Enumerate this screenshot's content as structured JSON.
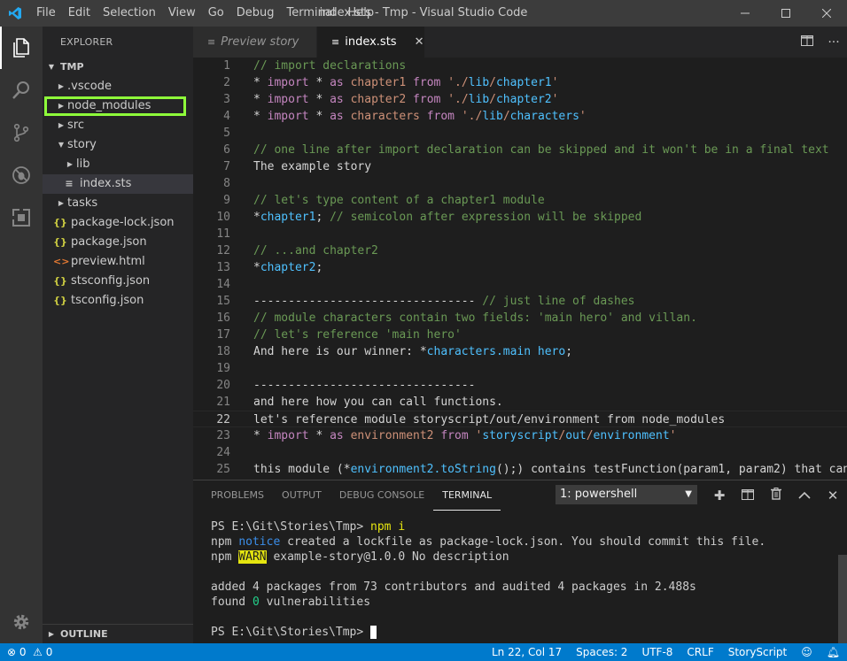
{
  "window": {
    "title": "index.sts - Tmp - Visual Studio Code",
    "menu": [
      "File",
      "Edit",
      "Selection",
      "View",
      "Go",
      "Debug",
      "Terminal",
      "Help"
    ]
  },
  "sidebar": {
    "title": "EXPLORER",
    "root": "TMP",
    "items": [
      {
        "label": ".vscode"
      },
      {
        "label": "node_modules"
      },
      {
        "label": "src"
      },
      {
        "label": "story"
      },
      {
        "label": "lib"
      },
      {
        "label": "index.sts"
      },
      {
        "label": "tasks"
      },
      {
        "label": "package-lock.json"
      },
      {
        "label": "package.json"
      },
      {
        "label": "preview.html"
      },
      {
        "label": "stsconfig.json"
      },
      {
        "label": "tsconfig.json"
      }
    ],
    "outline": "OUTLINE"
  },
  "tabs": {
    "preview": "Preview story",
    "index": "index.sts"
  },
  "panel": {
    "tabs": [
      "PROBLEMS",
      "OUTPUT",
      "DEBUG CONSOLE",
      "TERMINAL"
    ],
    "terminal_select": "1: powershell",
    "terminal": {
      "prompt1": "PS E:\\Git\\Stories\\Tmp> ",
      "cmd": "npm i",
      "l2a": "npm ",
      "l2b": "notice",
      "l2c": " created a lockfile as package-lock.json. You should commit this file.",
      "l3a": "npm ",
      "l3b": "WARN",
      "l3c": " example-story@1.0.0 No description",
      "l5": "added 4 packages from 73 contributors and audited 4 packages in 2.488s",
      "l6a": "found ",
      "l6b": "0",
      "l6c": " vulnerabilities",
      "prompt2": "PS E:\\Git\\Stories\\Tmp> "
    }
  },
  "statusbar": {
    "errors": "0",
    "warnings": "0",
    "position": "Ln 22, Col 17",
    "spaces": "Spaces: 2",
    "encoding": "UTF-8",
    "eol": "CRLF",
    "language": "StoryScript"
  }
}
